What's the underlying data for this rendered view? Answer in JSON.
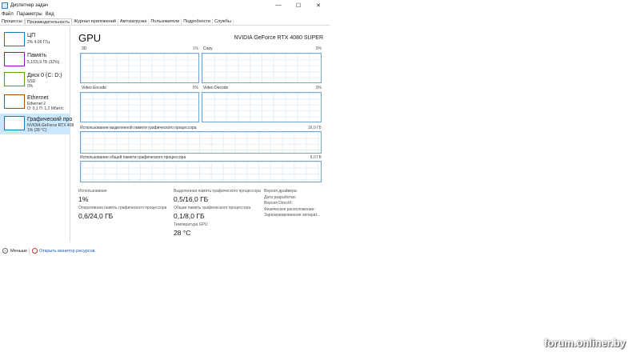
{
  "window": {
    "title": "Диспетчер задач"
  },
  "window_controls": {
    "minimize": "—",
    "maximize": "☐",
    "close": "✕"
  },
  "menu": [
    "Файл",
    "Параметры",
    "Вид"
  ],
  "tabs": [
    "Процессы",
    "Производительность",
    "Журнал приложений",
    "Автозагрузка",
    "Пользователи",
    "Подробности",
    "Службы"
  ],
  "sidebar": [
    {
      "name": "ЦП",
      "sub1": "2% 4,06 ГГц",
      "sub2": "",
      "sub3": "",
      "color": "#117dbb"
    },
    {
      "name": "Память",
      "sub1": "5,1/15,9 ГБ (32%)",
      "sub2": "",
      "sub3": "",
      "color": "#8b12ae"
    },
    {
      "name": "Диск 0 (C: D:)",
      "sub1": "SSD",
      "sub2": "0%",
      "sub3": "",
      "color": "#4da60c"
    },
    {
      "name": "Ethernet",
      "sub1": "Ethernet 2",
      "sub2": "О: 0,1 П: 1,2 Мбит/с",
      "sub3": "",
      "color": "#a74f01"
    },
    {
      "name": "Графический про",
      "sub1": "NVIDIA GeForce RTX 408",
      "sub2": "1% (28 °C)",
      "sub3": "",
      "color": "#117dbb"
    }
  ],
  "gpu": {
    "title": "GPU",
    "model": "NVIDIA GeForce RTX 4080 SUPER",
    "engines": [
      {
        "label": "3D",
        "pct": "1%"
      },
      {
        "label": "Copy",
        "pct": "0%"
      },
      {
        "label": "Video Encode",
        "pct": "0%"
      },
      {
        "label": "Video Decode",
        "pct": "0%"
      }
    ],
    "dedicated_label": "Использование выделенной памяти графического процессора",
    "dedicated_max": "16,0 ГБ",
    "shared_label": "Использование общей памяти графического процессора",
    "shared_max": "8,0 ГБ"
  },
  "stats": {
    "usage_label": "Использование",
    "usage_value": "1%",
    "gpu_mem_label": "Оперативная память графического процессора",
    "gpu_mem_value": "0,6/24,0 ГБ",
    "dedicated_label": "Выделенная память графического процессора",
    "dedicated_value": "0,5/16,0 ГБ",
    "shared_label": "Общая память графического процессора",
    "shared_value": "0,1/8,0 ГБ",
    "temp_label": "Температура GPU",
    "temp_value": "28 °C"
  },
  "info": [
    "Версия драйвера:",
    "Дата разработки:",
    "Версия DirectX:",
    "Физическое расположение:",
    "Зарезервированная аппарат..."
  ],
  "footer": {
    "less": "Меньше",
    "monitor": "Открыть монитор ресурсов"
  },
  "watermark": "forum.onliner.by",
  "colors": {
    "accent": "#117dbb",
    "selected_bg": "#cce8ff",
    "graph_border": "#6fa6d6"
  }
}
